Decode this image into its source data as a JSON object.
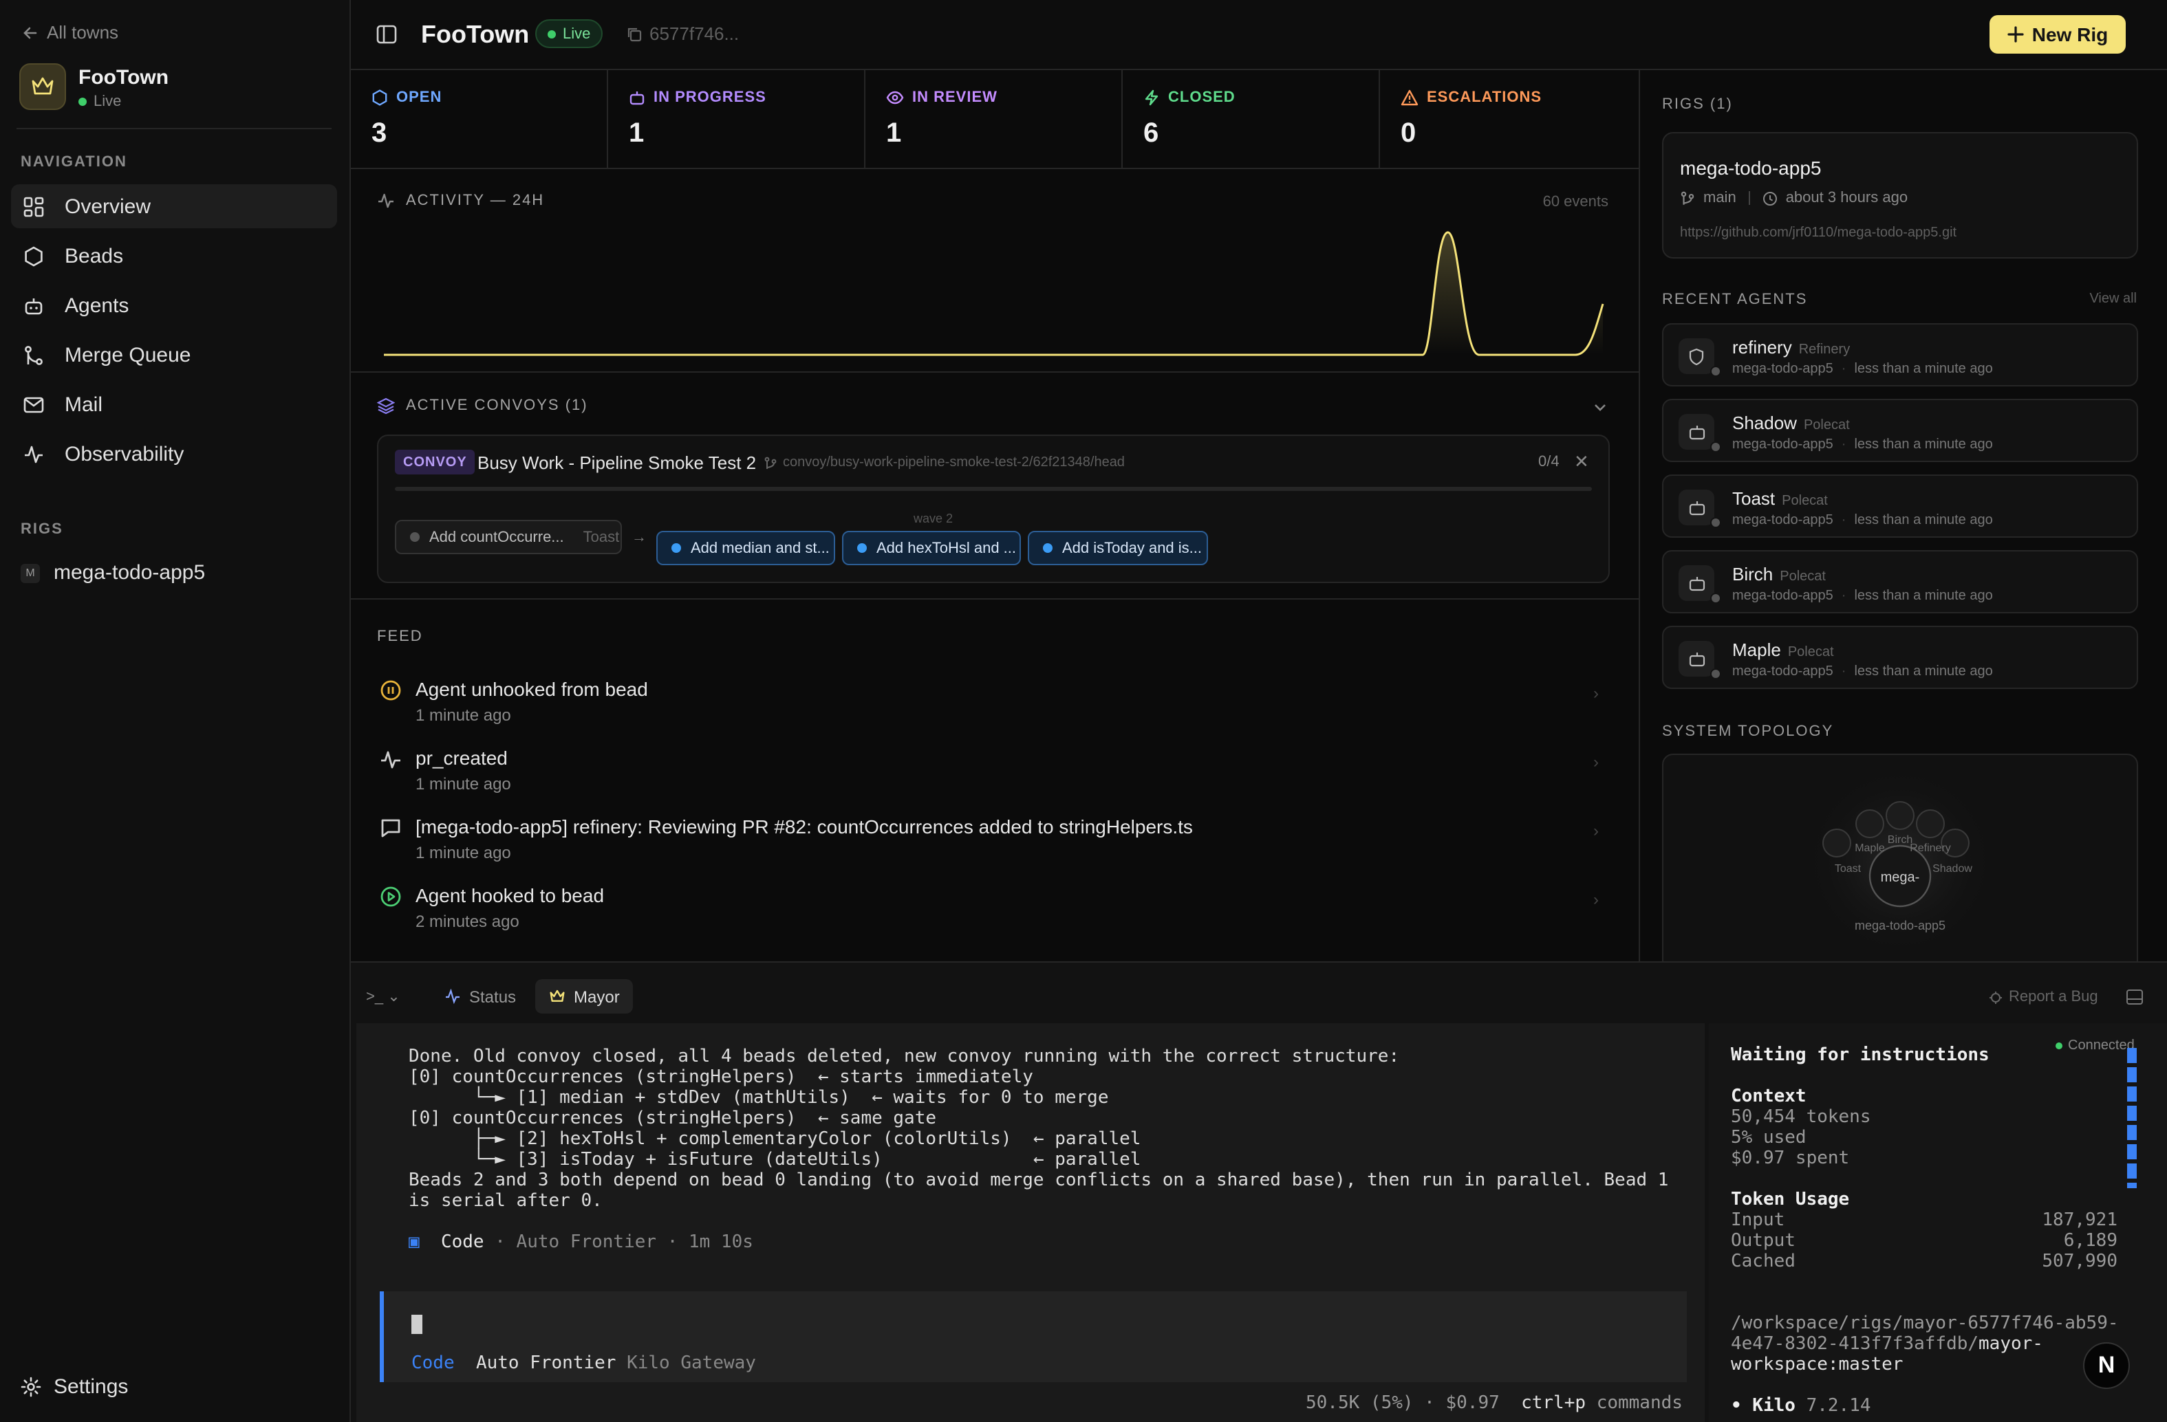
{
  "sidebar": {
    "back_label": "All towns",
    "town_name": "FooTown",
    "town_status": "Live",
    "navigation_header": "NAVIGATION",
    "nav_items": [
      {
        "label": "Overview",
        "icon": "grid-icon"
      },
      {
        "label": "Beads",
        "icon": "hexagon-icon"
      },
      {
        "label": "Agents",
        "icon": "bot-icon"
      },
      {
        "label": "Merge Queue",
        "icon": "git-merge-icon"
      },
      {
        "label": "Mail",
        "icon": "mail-icon"
      },
      {
        "label": "Observability",
        "icon": "activity-icon"
      }
    ],
    "rigs_header": "RIGS",
    "rigs": [
      {
        "badge": "M",
        "label": "mega-todo-app5"
      }
    ],
    "settings_label": "Settings"
  },
  "topbar": {
    "title": "FooTown",
    "status": "Live",
    "town_id": "6577f746...",
    "new_rig_label": "New Rig"
  },
  "stats": [
    {
      "label": "OPEN",
      "value": "3",
      "color": "#6fa8ff"
    },
    {
      "label": "IN PROGRESS",
      "value": "1",
      "color": "#b48cff"
    },
    {
      "label": "IN REVIEW",
      "value": "1",
      "color": "#c48cff"
    },
    {
      "label": "CLOSED",
      "value": "6",
      "color": "#5fdc8c"
    },
    {
      "label": "ESCALATIONS",
      "value": "0",
      "color": "#ff9a5a"
    }
  ],
  "activity": {
    "title": "ACTIVITY — 24H",
    "events": "60 events",
    "accent": "#f5e37a"
  },
  "convoys": {
    "title": "ACTIVE CONVOYS (1)",
    "badge": "CONVOY",
    "name": "Busy Work - Pipeline Smoke Test 2",
    "branch": "convoy/busy-work-pipeline-smoke-test-2/62f21348/head",
    "progress": "0/4",
    "progress_fraction": 0,
    "wave_label": "wave 2",
    "beads": [
      {
        "label": "Add countOccurre...",
        "assignee": "Toast"
      },
      {
        "label": "Add median and st..."
      },
      {
        "label": "Add hexToHsl and ..."
      },
      {
        "label": "Add isToday and is..."
      }
    ]
  },
  "feed": {
    "title": "FEED",
    "items": [
      {
        "icon": "pause-circle-icon",
        "title": "Agent unhooked from bead",
        "time": "1 minute ago"
      },
      {
        "icon": "activity-icon",
        "title": "pr_created",
        "time": "1 minute ago"
      },
      {
        "icon": "message-square-icon",
        "title": "[mega-todo-app5] refinery: Reviewing PR #82: countOccurrences added to stringHelpers.ts",
        "time": "1 minute ago"
      },
      {
        "icon": "play-circle-icon",
        "title": "Agent hooked to bead",
        "time": "2 minutes ago"
      }
    ]
  },
  "rigs_panel": {
    "title": "RIGS (1)",
    "rig": {
      "name": "mega-todo-app5",
      "branch": "main",
      "updated": "about 3 hours ago",
      "url": "https://github.com/jrf0110/mega-todo-app5.git"
    }
  },
  "agents_panel": {
    "title": "RECENT AGENTS",
    "view_all": "View all",
    "agents": [
      {
        "name": "refinery",
        "role": "Refinery",
        "rig": "mega-todo-app5",
        "time": "less than a minute ago"
      },
      {
        "name": "Shadow",
        "role": "Polecat",
        "rig": "mega-todo-app5",
        "time": "less than a minute ago"
      },
      {
        "name": "Toast",
        "role": "Polecat",
        "rig": "mega-todo-app5",
        "time": "less than a minute ago"
      },
      {
        "name": "Birch",
        "role": "Polecat",
        "rig": "mega-todo-app5",
        "time": "less than a minute ago"
      },
      {
        "name": "Maple",
        "role": "Polecat",
        "rig": "mega-todo-app5",
        "time": "less than a minute ago"
      }
    ]
  },
  "topology": {
    "title": "SYSTEM TOPOLOGY",
    "center": "mega-",
    "center_caption": "mega-todo-app5",
    "nodes": [
      "Toast",
      "Maple",
      "Birch",
      "Refinery",
      "Shadow"
    ]
  },
  "terminal": {
    "prompt_symbol": ">_",
    "tabs": [
      {
        "label": "Status"
      },
      {
        "label": "Mayor"
      }
    ],
    "report_bug": "Report a Bug",
    "output": [
      "Done. Old convoy closed, all 4 beads deleted, new convoy running with the correct structure:",
      "[0] countOccurrences (stringHelpers)  ← starts immediately",
      "      └─► [1] median + stdDev (mathUtils)  ← waits for 0 to merge",
      "",
      "[0] countOccurrences (stringHelpers)  ← same gate",
      "      ├─► [2] hexToHsl + complementaryColor (colorUtils)  ← parallel",
      "      └─► [3] isToday + isFuture (dateUtils)              ← parallel",
      "Beads 2 and 3 both depend on bead 0 landing (to avoid merge conflicts on a shared base), then run in parallel. Bead 1",
      "is serial after 0."
    ],
    "mode": "Code",
    "model_line": "· Auto Frontier · 1m 10s",
    "prompt_mode": "Code",
    "prompt_model": "Auto Frontier",
    "prompt_provider": "Kilo Gateway",
    "status_line": "50.5K (5%) · $0.97",
    "shortcut": "ctrl+p",
    "shortcut_label": "commands",
    "side": {
      "connected": "Connected",
      "heading": "Waiting for instructions",
      "context_title": "Context",
      "tokens": "50,454 tokens",
      "used": "5% used",
      "spent": "$0.97 spent",
      "usage_title": "Token Usage",
      "usage": [
        {
          "label": "Input",
          "value": "187,921"
        },
        {
          "label": "Output",
          "value": "6,189"
        },
        {
          "label": "Cached",
          "value": "507,990"
        }
      ],
      "path_1": "/workspace/rigs/mayor-6577f746-ab59-",
      "path_2": "4e47-8302-413f7f3affdb/",
      "path_3": "mayor-",
      "path_4": "workspace:master",
      "kilo_label": "• Kilo",
      "kilo_version": "7.2.14"
    }
  },
  "fab_label": "N"
}
